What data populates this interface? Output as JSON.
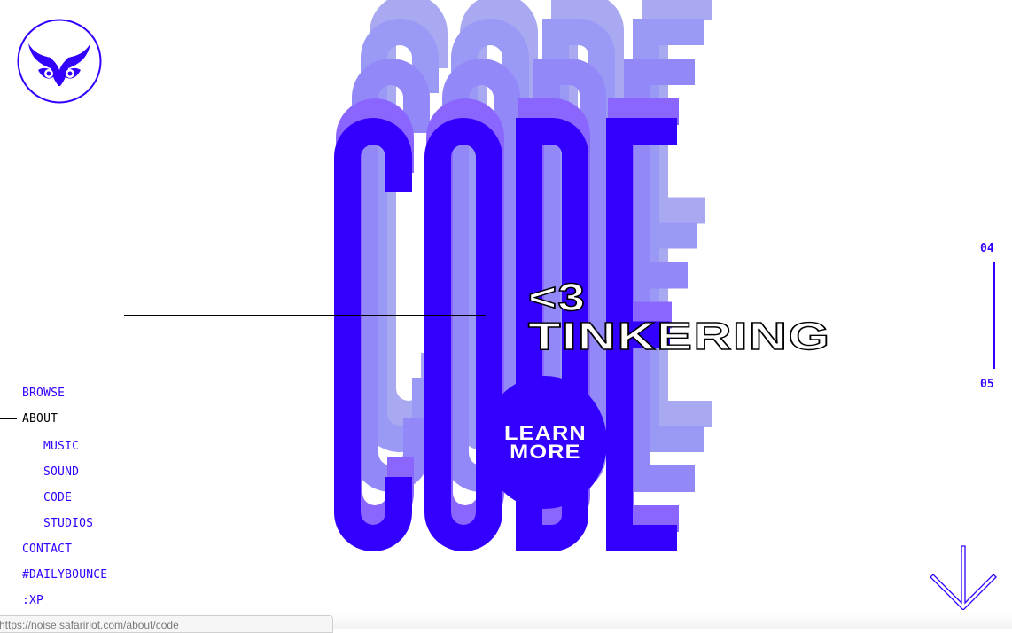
{
  "logo": {
    "label": "Safari Riot logo",
    "icon": "owl-mask-icon"
  },
  "hero": {
    "word": "CODE",
    "headline_line1": "<3",
    "headline_line2": "TINKERING",
    "cta_line1": "LEARN",
    "cta_line2": "MORE"
  },
  "nav": {
    "items": [
      {
        "label": "BROWSE",
        "active": false,
        "sub": false
      },
      {
        "label": "ABOUT",
        "active": true,
        "sub": false
      },
      {
        "label": "MUSIC",
        "active": false,
        "sub": true
      },
      {
        "label": "SOUND",
        "active": false,
        "sub": true
      },
      {
        "label": "CODE",
        "active": false,
        "sub": true
      },
      {
        "label": "STUDIOS",
        "active": false,
        "sub": true
      },
      {
        "label": "CONTACT",
        "active": false,
        "sub": false
      },
      {
        "label": "#DAILYBOUNCE",
        "active": false,
        "sub": false
      },
      {
        "label": ":XP",
        "active": false,
        "sub": false
      }
    ]
  },
  "pager": {
    "current": "04",
    "next": "05"
  },
  "scroll": {
    "icon": "arrow-down-icon"
  },
  "status_bar": {
    "url": "https://noise.safaririot.com/about/code"
  },
  "colors": {
    "accent": "#3300ff",
    "layer1": "#8a66ff",
    "layer2": "#9288f8",
    "layer3": "#9a99f5",
    "layer4": "#a9a9f2",
    "text": "#000000"
  }
}
